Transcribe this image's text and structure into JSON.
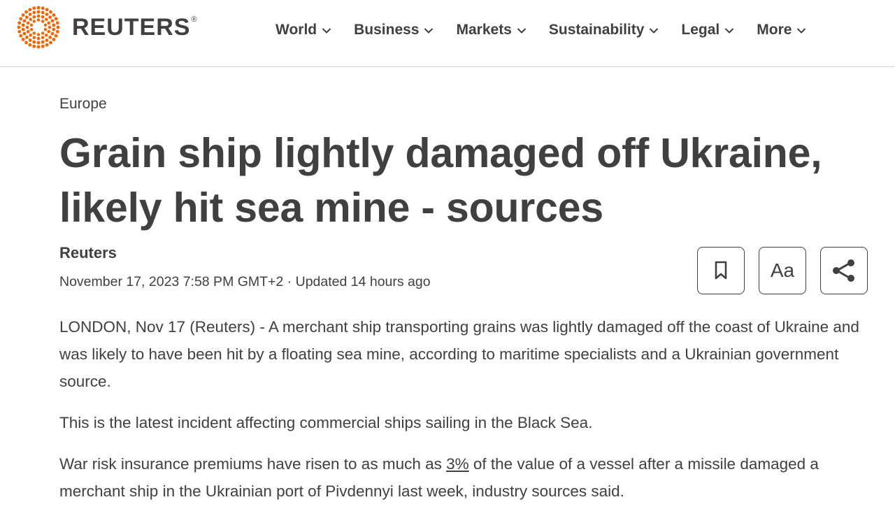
{
  "brand": {
    "name": "REUTERS",
    "reg": "®",
    "accent": "#fa6400",
    "text_color": "#404040"
  },
  "nav": {
    "items": [
      {
        "label": "World"
      },
      {
        "label": "Business"
      },
      {
        "label": "Markets"
      },
      {
        "label": "Sustainability"
      },
      {
        "label": "Legal"
      },
      {
        "label": "More"
      }
    ]
  },
  "article": {
    "section": "Europe",
    "headline": "Grain ship lightly damaged off Ukraine, likely hit sea mine - sources",
    "byline": "Reuters",
    "dateline": "November 17, 2023 7:58 PM GMT+2 · Updated 14 hours ago",
    "tools": {
      "bookmark_icon": "bookmark-icon",
      "text_size_label": "Aa",
      "share_icon": "share-icon"
    },
    "paragraphs": {
      "p1": "LONDON, Nov 17 (Reuters) - A merchant ship transporting grains was lightly damaged off the coast of Ukraine and was likely to have been hit by a floating sea mine, according to maritime specialists and a Ukrainian government source.",
      "p2": "This is the latest incident affecting commercial ships sailing in the Black Sea.",
      "p3_before": "War risk insurance premiums have risen to as much as ",
      "p3_link": "3%",
      "p3_after": " of the value of a vessel after a missile damaged a merchant ship in the Ukrainian port of Pivdennyi last week, industry sources said."
    }
  }
}
